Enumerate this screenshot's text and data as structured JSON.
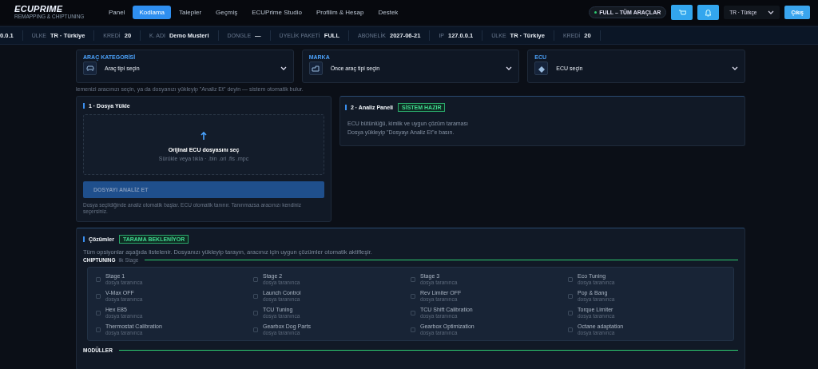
{
  "header": {
    "logo_title": "ECUPRIME",
    "logo_subtitle": "REMAPPING & CHIPTUNING",
    "nav": [
      {
        "label": "Panel",
        "selected": false
      },
      {
        "label": "Kodlama",
        "selected": true
      },
      {
        "label": "Talepler",
        "selected": false
      },
      {
        "label": "Geçmiş",
        "selected": false
      },
      {
        "label": "ECUPrime Studio",
        "selected": false
      },
      {
        "label": "Profilim & Hesap",
        "selected": false
      },
      {
        "label": "Destek",
        "selected": false
      }
    ],
    "plan_badge": "FULL – TÜM ARAÇLAR",
    "language": "TR · Türkçe",
    "logout": "Çıkış"
  },
  "ticker": [
    {
      "value": "0.0.1"
    },
    {
      "label": "ÜLKE",
      "value": "TR · Türkiye"
    },
    {
      "label": "KREDİ",
      "value": "20"
    },
    {
      "label": "K. ADI",
      "value": "Demo Musteri"
    },
    {
      "label": "DONGLE",
      "value": "—"
    },
    {
      "label": "ÜYELİK PAKETİ",
      "value": "FULL"
    },
    {
      "label": "ABONELİK",
      "value": "2027-06-21"
    },
    {
      "label": "IP",
      "value": "127.0.0.1"
    },
    {
      "label": "ÜLKE",
      "value": "TR · Türkiye"
    },
    {
      "label": "KREDİ",
      "value": "20"
    }
  ],
  "selectors": [
    {
      "label": "ARAÇ KATEGORİSİ",
      "value": "Araç tipi seçin",
      "kind": "car"
    },
    {
      "label": "MARKA",
      "value": "Önce araç tipi seçin",
      "kind": "brand"
    },
    {
      "label": "ECU",
      "value": "ECU seçin",
      "kind": "chip"
    }
  ],
  "selector_hint": "lemenizi aracınızı seçin, ya da dosyanızı yükleyip \"Analiz Et\" deyin — sistem otomatik bulur.",
  "upload_card": {
    "title": "1 · Dosya Yükle",
    "drop_title": "Orijinal ECU dosyasını seç",
    "drop_hint": "Sürükle veya tıkla · .bin .ori .fls .mpc",
    "button": "DOSYAYI ANALİZ ET",
    "button_disabled": true,
    "note": "Dosya seçildiğinde analiz otomatik başlar. ECU otomatik tanınır. Tanınmazsa aracınızı kendiniz seçersiniz."
  },
  "analysis_card": {
    "title": "2 · Analiz Paneli",
    "badge": "SİSTEM HAZIR",
    "lines": [
      "ECU bütünlüğü, kimlik ve uygun çözüm taraması",
      "Dosya yükleyip \"Dosyayı Analiz Et\"e basın."
    ]
  },
  "solutions": {
    "title": "Çözümler",
    "badge": "TARAMA BEKLENİYOR",
    "description": "Tüm opsiyonlar aşağıda listelenir. Dosyanızı yükleyip tarayın, aracınız için uygun çözümler otomatik aktifleşir.",
    "groups": [
      {
        "title": "CHIPTUNING",
        "subtitle": "ilk Stage",
        "options": [
          {
            "label": "Stage 1",
            "status": "dosya taranınca",
            "checked": false
          },
          {
            "label": "Stage 2",
            "status": "dosya taranınca",
            "checked": false
          },
          {
            "label": "Stage 3",
            "status": "dosya taranınca",
            "checked": false
          },
          {
            "label": "Eco Tuning",
            "status": "dosya taranınca",
            "checked": false
          },
          {
            "label": "V-Max OFF",
            "status": "dosya taranınca",
            "checked": false
          },
          {
            "label": "Launch Control",
            "status": "dosya taranınca",
            "checked": false
          },
          {
            "label": "Rev Limiter OFF",
            "status": "dosya taranınca",
            "checked": false
          },
          {
            "label": "Pop & Bang",
            "status": "dosya taranınca",
            "checked": false
          },
          {
            "label": "Hex E85",
            "status": "dosya taranınca",
            "checked": false
          },
          {
            "label": "TCU Tuning",
            "status": "dosya taranınca",
            "checked": false
          },
          {
            "label": "TCU Shift Calibration",
            "status": "dosya taranınca",
            "checked": false
          },
          {
            "label": "Torque Limiter",
            "status": "dosya taranınca",
            "checked": false
          },
          {
            "label": "Thermostat Calibration",
            "status": "dosya taranınca",
            "checked": false
          },
          {
            "label": "Gearbox Dog Parts",
            "status": "dosya taranınca",
            "checked": false
          },
          {
            "label": "Gearbox Optimization",
            "status": "dosya taranınca",
            "checked": false
          },
          {
            "label": "Octane adaptation",
            "status": "dosya taranınca",
            "checked": false
          }
        ]
      },
      {
        "title": "MODÜLLER"
      }
    ]
  }
}
